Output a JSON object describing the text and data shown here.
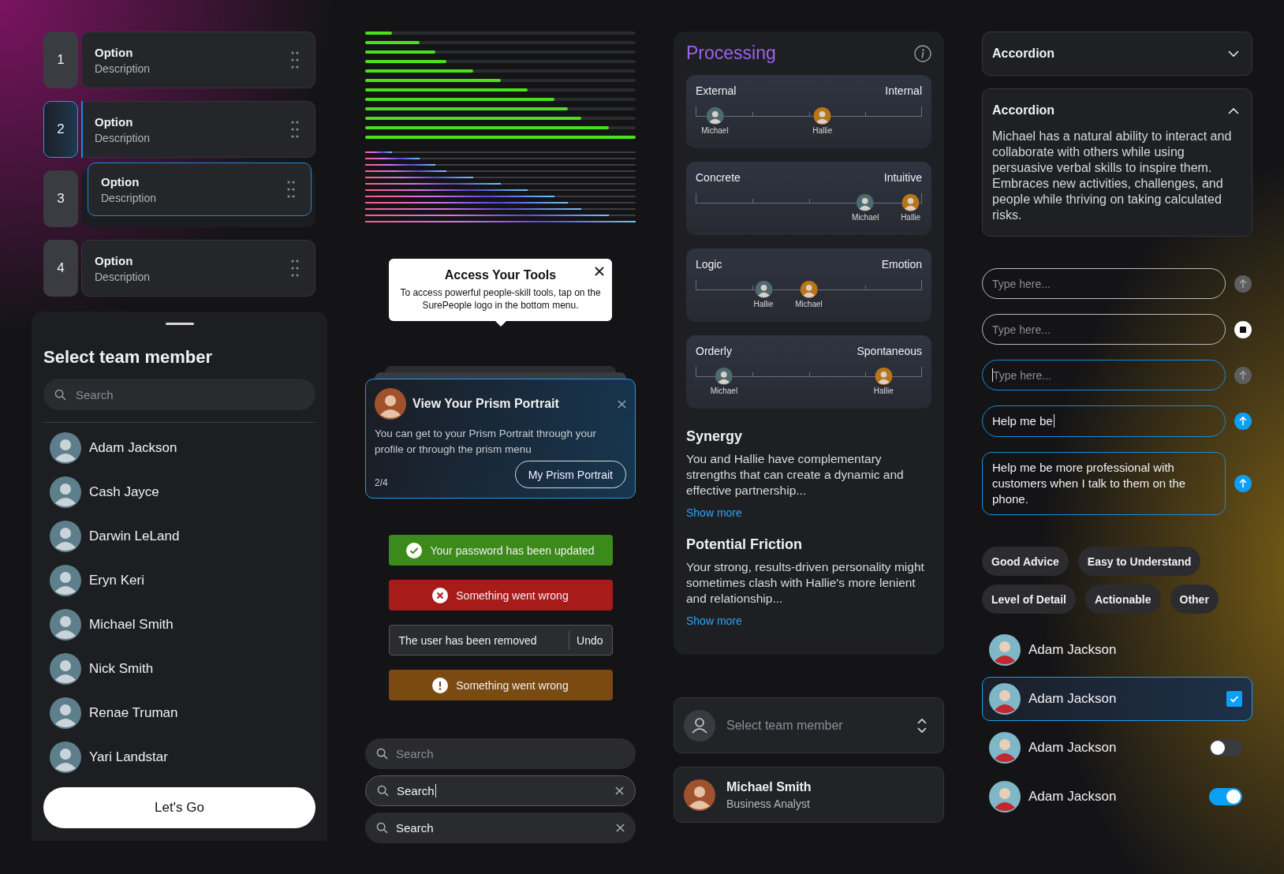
{
  "reorder_list": {
    "items": [
      {
        "number": "1",
        "title": "Option",
        "description": "Description",
        "kind": "option",
        "selected": false
      },
      {
        "number": "2",
        "title": "Option",
        "description": "Description",
        "kind": "option",
        "selected": true
      },
      {
        "number": "3",
        "kind": "drop_slot",
        "selected": false
      },
      {
        "number": "4",
        "title": "Option",
        "description": "Description",
        "kind": "option",
        "selected": false
      }
    ],
    "dragged_item": {
      "title": "Option",
      "description": "Description"
    }
  },
  "team_sheet": {
    "title": "Select team member",
    "search": {
      "placeholder": "Search"
    },
    "members": [
      {
        "name": "Adam Jackson"
      },
      {
        "name": "Cash Jayce"
      },
      {
        "name": "Darwin LeLand"
      },
      {
        "name": "Eryn Keri"
      },
      {
        "name": "Michael Smith"
      },
      {
        "name": "Nick Smith"
      },
      {
        "name": "Renae Truman"
      },
      {
        "name": "Yari Landstar"
      }
    ],
    "button": "Let's Go"
  },
  "progress_bars": {
    "solid": [
      {
        "level": 0.1
      },
      {
        "level": 0.2
      },
      {
        "level": 0.26
      },
      {
        "level": 0.3
      },
      {
        "level": 0.4
      },
      {
        "level": 0.5
      },
      {
        "level": 0.6
      },
      {
        "level": 0.7
      },
      {
        "level": 0.75
      },
      {
        "level": 0.8
      },
      {
        "level": 0.9
      },
      {
        "level": 1
      }
    ],
    "gradient": [
      {
        "level": 0.1
      },
      {
        "level": 0.2
      },
      {
        "level": 0.26
      },
      {
        "level": 0.3
      },
      {
        "level": 0.4
      },
      {
        "level": 0.5
      },
      {
        "level": 0.6
      },
      {
        "level": 0.7
      },
      {
        "level": 0.75
      },
      {
        "level": 0.8
      },
      {
        "level": 0.9
      },
      {
        "level": 1
      }
    ]
  },
  "tooltip": {
    "title": "Access Your Tools",
    "text": "To access powerful people-skill tools, tap on the SurePeople logo in the bottom menu."
  },
  "tour_card": {
    "title": "View Your Prism Portrait",
    "text": "You can get to your Prism Portrait through your profile or through the prism menu",
    "step": "2/4",
    "button": "My Prism Portrait"
  },
  "toasts": [
    {
      "kind": "success",
      "text": "Your password has been updated"
    },
    {
      "kind": "error",
      "text": "Something went wrong"
    },
    {
      "kind": "neutral",
      "text": "The user has been removed",
      "action": "Undo"
    },
    {
      "kind": "warning",
      "text": "Something went wrong"
    }
  ],
  "search_fields": [
    {
      "placeholder": "Search",
      "focused": false
    },
    {
      "value": "Search",
      "focused": true
    },
    {
      "value": "Search",
      "focused": false
    }
  ],
  "processing": {
    "title": "Processing",
    "scales": [
      {
        "left": "External",
        "right": "Internal",
        "markers": [
          {
            "name": "Michael",
            "level": 0.085
          },
          {
            "name": "Hallie",
            "level": 0.56
          }
        ]
      },
      {
        "left": "Concrete",
        "right": "Intuitive",
        "markers": [
          {
            "name": "Michael",
            "level": 0.75
          },
          {
            "name": "Hallie",
            "level": 0.95
          }
        ]
      },
      {
        "left": "Logic",
        "right": "Emotion",
        "markers": [
          {
            "name": "Hallie",
            "level": 0.3
          },
          {
            "name": "Michael",
            "level": 0.5
          }
        ]
      },
      {
        "left": "Orderly",
        "right": "Spontaneous",
        "markers": [
          {
            "name": "Michael",
            "level": 0.125
          },
          {
            "name": "Hallie",
            "level": 0.83
          }
        ]
      }
    ],
    "sections": [
      {
        "title": "Synergy",
        "text": "You and Hallie have complementary strengths that can create a dynamic and effective partnership...",
        "link": "Show more"
      },
      {
        "title": "Potential Friction",
        "text": "Your strong, results-driven personality might sometimes clash with Hallie's more lenient and relationship...",
        "link": "Show more"
      }
    ]
  },
  "select_field": {
    "placeholder": "Select team member"
  },
  "member_card": {
    "name": "Michael Smith",
    "role": "Business Analyst"
  },
  "accordions": [
    {
      "title": "Accordion",
      "expanded": false
    },
    {
      "title": "Accordion",
      "expanded": true,
      "body": "Michael has a natural ability to interact and collaborate with others while using persuasive verbal skills to inspire them. Embraces new activities, challenges, and people while thriving on taking calculated risks."
    }
  ],
  "chat_inputs": [
    {
      "placeholder": "Type here...",
      "focused": false,
      "cursor": false,
      "kind": "send_disabled"
    },
    {
      "placeholder": "Type here...",
      "focused": false,
      "cursor": false,
      "kind": "stop"
    },
    {
      "placeholder": "Type here...",
      "focused": true,
      "cursor": true,
      "kind": "send_disabled"
    },
    {
      "value": "Help me be",
      "focused": true,
      "cursor": true,
      "kind": "send"
    },
    {
      "value": "Help me be more professional with customers when I talk to them on the phone.",
      "focused": true,
      "cursor": false,
      "kind": "send"
    }
  ],
  "feedback_chips": [
    "Good Advice",
    "Easy to Understand",
    "Level of Detail",
    "Actionable",
    "Other"
  ],
  "member_rows": [
    {
      "name": "Adam Jackson",
      "kind": "plain",
      "selected": false
    },
    {
      "name": "Adam Jackson",
      "kind": "checkbox",
      "selected": true,
      "checked": true
    },
    {
      "name": "Adam Jackson",
      "kind": "toggle",
      "selected": false,
      "on": false
    },
    {
      "name": "Adam Jackson",
      "kind": "toggle",
      "selected": false,
      "on": true
    }
  ]
}
